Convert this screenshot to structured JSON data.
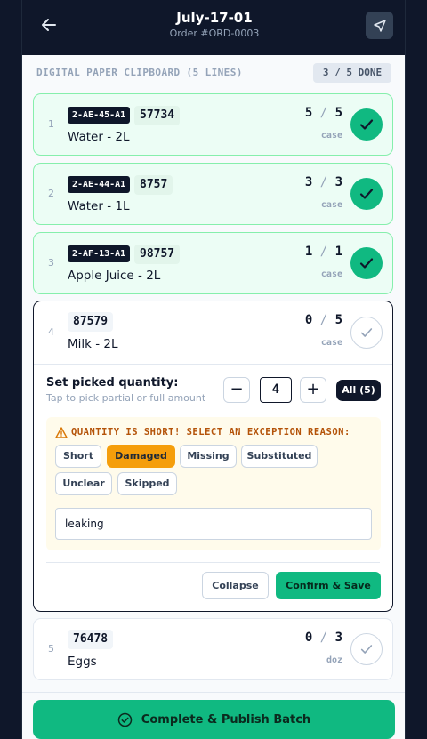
{
  "header": {
    "title": "July-17-01",
    "subtitle": "Order #ORD-0003",
    "back_icon": "arrow-left-icon",
    "navigate_icon": "navigation-arrow-icon"
  },
  "section": {
    "title": "DIGITAL PAPER CLIPBOARD (5 LINES)",
    "progress": "3 / 5 DONE"
  },
  "items": [
    {
      "index": "1",
      "location": "2-AE-45-A1",
      "sku": "57734",
      "name": "Water - 2L",
      "picked": "5",
      "required": "5",
      "unit": "case",
      "done": true
    },
    {
      "index": "2",
      "location": "2-AE-44-A1",
      "sku": "8757",
      "name": "Water - 1L",
      "picked": "3",
      "required": "3",
      "unit": "case",
      "done": true
    },
    {
      "index": "3",
      "location": "2-AF-13-A1",
      "sku": "98757",
      "name": "Apple Juice - 2L",
      "picked": "1",
      "required": "1",
      "unit": "case",
      "done": true
    },
    {
      "index": "4",
      "location": "",
      "sku": "87579",
      "name": "Milk - 2L",
      "picked": "0",
      "required": "5",
      "unit": "case",
      "done": false
    },
    {
      "index": "5",
      "location": "",
      "sku": "76478",
      "name": "Eggs",
      "picked": "0",
      "required": "3",
      "unit": "doz",
      "done": false
    }
  ],
  "picker": {
    "label": "Set picked quantity:",
    "hint": "Tap to pick partial or full amount",
    "minus": "−",
    "plus": "+",
    "value": "4",
    "all_label": "All (5)"
  },
  "exception": {
    "title": "QUANTITY IS SHORT! SELECT AN EXCEPTION REASON:",
    "reasons": [
      "Short",
      "Damaged",
      "Missing",
      "Substituted",
      "Unclear",
      "Skipped"
    ],
    "selected": "Damaged",
    "note": "leaking"
  },
  "actions": {
    "collapse": "Collapse",
    "confirm": "Confirm & Save"
  },
  "footer": {
    "publish": "Complete & Publish Batch"
  },
  "colors": {
    "header_bg": "#0f172a",
    "accent_green": "#10b981",
    "done_bg": "#ecfdf5",
    "warning_amber": "#f59e0b"
  }
}
